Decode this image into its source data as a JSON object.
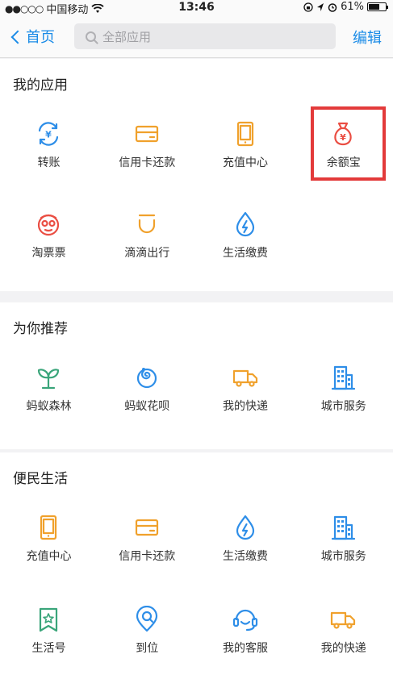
{
  "status_bar": {
    "signal": "●●○○○",
    "carrier": "中国移动",
    "time": "13:46",
    "battery_text": "61%",
    "battery_level": 0.61
  },
  "navbar": {
    "back_label": "首页",
    "search_placeholder": "全部应用",
    "edit_label": "编辑"
  },
  "sections": [
    {
      "title": "我的应用",
      "items": [
        {
          "label": "转账",
          "icon": "transfer-icon",
          "color": "#2e8ee8"
        },
        {
          "label": "信用卡还款",
          "icon": "credit-card-icon",
          "color": "#f0a12c"
        },
        {
          "label": "充值中心",
          "icon": "phone-recharge-icon",
          "color": "#f0a12c"
        },
        {
          "label": "余额宝",
          "icon": "money-bag-icon",
          "color": "#ea4e43"
        },
        {
          "label": "淘票票",
          "icon": "taopiaopiao-icon",
          "color": "#ea4e43"
        },
        {
          "label": "滴滴出行",
          "icon": "didi-icon",
          "color": "#f0a12c"
        },
        {
          "label": "生活缴费",
          "icon": "utility-drop-icon",
          "color": "#2e8ee8"
        }
      ]
    },
    {
      "title": "为你推荐",
      "items": [
        {
          "label": "蚂蚁森林",
          "icon": "sprout-icon",
          "color": "#3aa57a"
        },
        {
          "label": "蚂蚁花呗",
          "icon": "huabei-icon",
          "color": "#2e8ee8"
        },
        {
          "label": "我的快递",
          "icon": "truck-icon",
          "color": "#f0a12c"
        },
        {
          "label": "城市服务",
          "icon": "city-building-icon",
          "color": "#2e8ee8"
        }
      ]
    },
    {
      "title": "便民生活",
      "items": [
        {
          "label": "充值中心",
          "icon": "phone-recharge-icon",
          "color": "#f0a12c"
        },
        {
          "label": "信用卡还款",
          "icon": "credit-card-icon",
          "color": "#f0a12c"
        },
        {
          "label": "生活缴费",
          "icon": "utility-drop-icon",
          "color": "#2e8ee8"
        },
        {
          "label": "城市服务",
          "icon": "city-building-icon",
          "color": "#2e8ee8"
        },
        {
          "label": "生活号",
          "icon": "bookmark-star-icon",
          "color": "#3aa57a"
        },
        {
          "label": "到位",
          "icon": "location-pin-icon",
          "color": "#2e8ee8"
        },
        {
          "label": "我的客服",
          "icon": "customer-service-icon",
          "color": "#2e8ee8"
        },
        {
          "label": "我的快递",
          "icon": "truck-icon",
          "color": "#f0a12c"
        }
      ]
    }
  ],
  "highlight_color": "#e33a3a"
}
